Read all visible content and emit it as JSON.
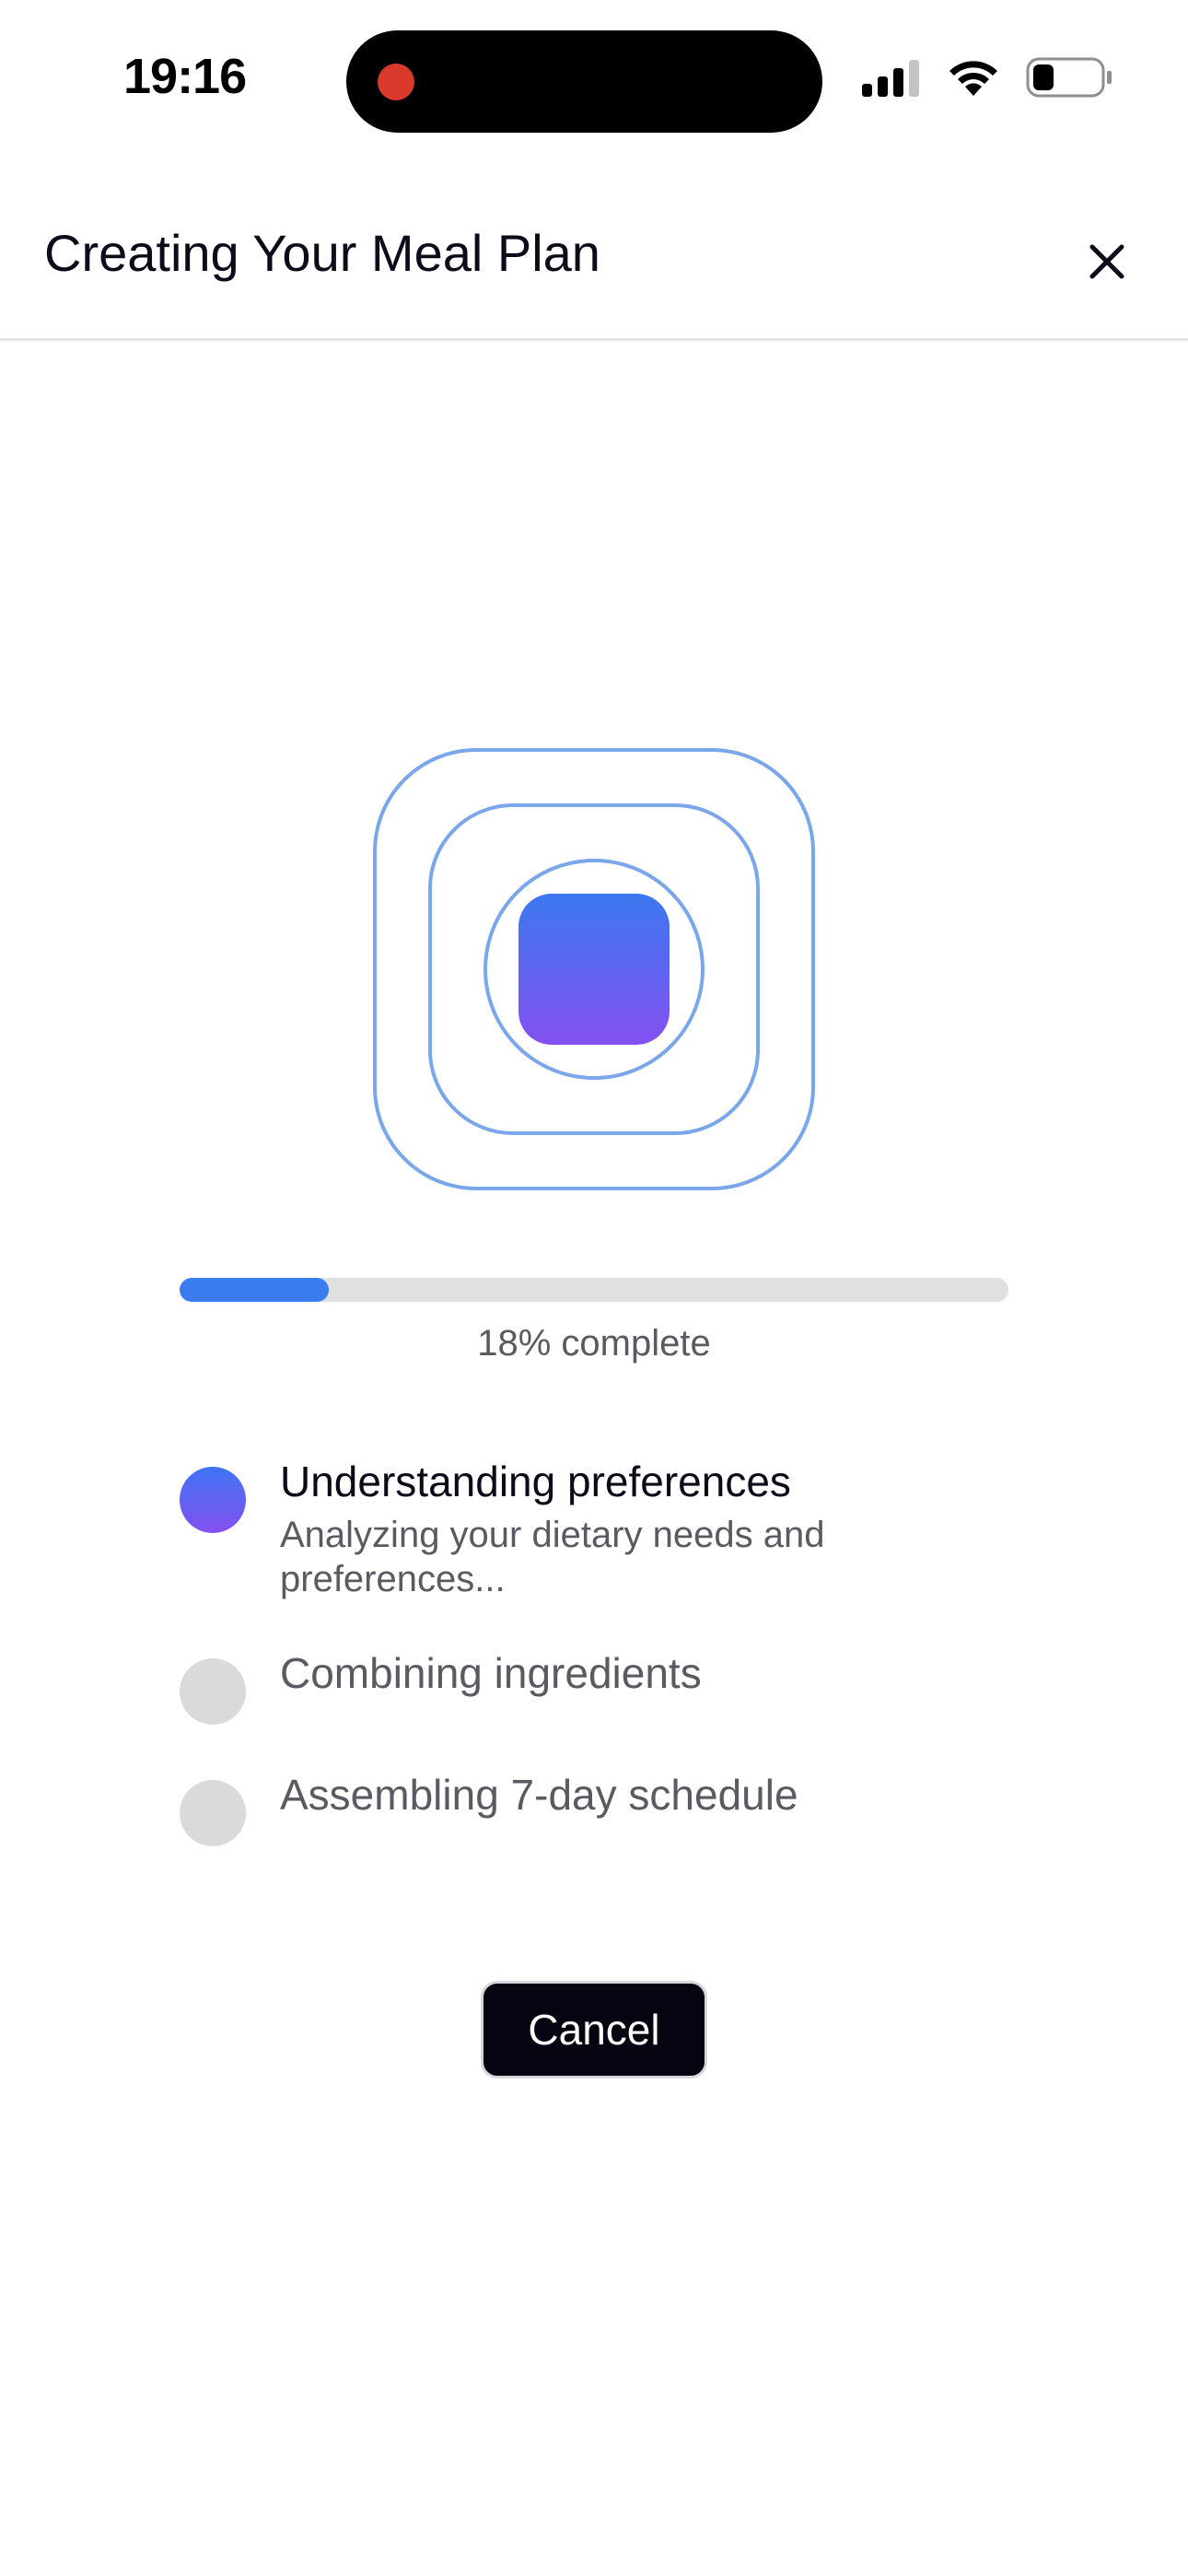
{
  "status_bar": {
    "time": "19:16",
    "icons": [
      "cellular-signal-icon",
      "wifi-icon",
      "battery-icon"
    ]
  },
  "header": {
    "title": "Creating Your Meal Plan",
    "close_icon": "close-icon"
  },
  "loader": {
    "icon": "generating-animation-icon",
    "colors": {
      "ring": "#7aa6ec",
      "gradient_top": "#3b78f0",
      "gradient_bottom": "#8451f0"
    }
  },
  "progress": {
    "percent": 18,
    "label": "18% complete",
    "fill_color": "#3b7bf0"
  },
  "steps": [
    {
      "title": "Understanding preferences",
      "description": "Analyzing your dietary needs and preferences...",
      "state": "active"
    },
    {
      "title": "Combining ingredients",
      "description": "",
      "state": "pending"
    },
    {
      "title": "Assembling 7-day schedule",
      "description": "",
      "state": "pending"
    }
  ],
  "actions": {
    "cancel_label": "Cancel"
  }
}
